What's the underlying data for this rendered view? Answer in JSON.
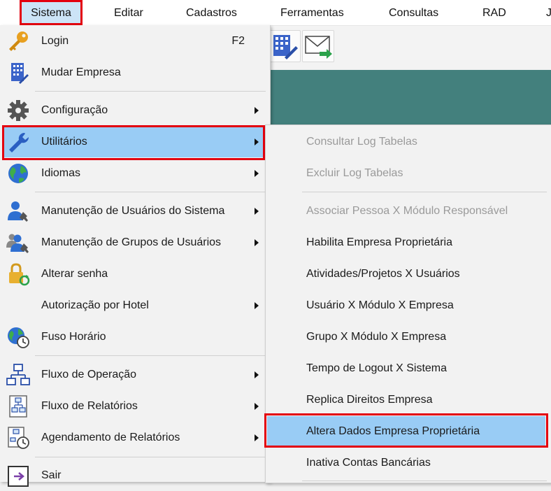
{
  "menubar": {
    "items": [
      "Sistema",
      "Editar",
      "Cadastros",
      "Ferramentas",
      "Consultas",
      "RAD",
      "J"
    ]
  },
  "sistema_menu": {
    "items": [
      {
        "label": "Login",
        "shortcut": "F2",
        "icon": "key-icon"
      },
      {
        "label": "Mudar Empresa",
        "icon": "building-icon"
      },
      {
        "label": "Configuração",
        "icon": "gear-icon",
        "submenu": true
      },
      {
        "label": "Utilitários",
        "icon": "wrench-icon",
        "submenu": true,
        "active": true
      },
      {
        "label": "Idiomas",
        "icon": "globe-icon",
        "submenu": true
      },
      {
        "label": "Manutenção de Usuários do Sistema",
        "icon": "user-settings-icon",
        "submenu": true
      },
      {
        "label": "Manutenção de Grupos de Usuários",
        "icon": "group-settings-icon",
        "submenu": true
      },
      {
        "label": "Alterar senha",
        "icon": "lock-refresh-icon"
      },
      {
        "label": "Autorização por Hotel",
        "submenu": true
      },
      {
        "label": "Fuso Horário",
        "icon": "globe-clock-icon"
      },
      {
        "label": "Fluxo de Operação",
        "icon": "flowchart-icon",
        "submenu": true
      },
      {
        "label": "Fluxo de Relatórios",
        "icon": "report-flow-icon",
        "submenu": true
      },
      {
        "label": "Agendamento de Relatórios",
        "icon": "report-schedule-icon",
        "submenu": true
      },
      {
        "label": "Sair",
        "icon": "exit-icon"
      }
    ]
  },
  "utilitarios_menu": {
    "items": [
      {
        "label": "Consultar Log Tabelas",
        "disabled": true
      },
      {
        "label": "Excluir Log Tabelas",
        "disabled": true
      },
      {
        "label": "Associar Pessoa X Módulo Responsável",
        "disabled": true
      },
      {
        "label": "Habilita Empresa Proprietária"
      },
      {
        "label": "Atividades/Projetos X Usuários"
      },
      {
        "label": "Usuário X Módulo X Empresa"
      },
      {
        "label": "Grupo X Módulo X Empresa"
      },
      {
        "label": "Tempo de Logout X Sistema"
      },
      {
        "label": "Replica Direitos Empresa"
      },
      {
        "label": "Altera Dados Empresa Proprietária",
        "active": true
      },
      {
        "label": "Inativa Contas Bancárias"
      }
    ]
  },
  "colors": {
    "highlight_box": "#e3000f",
    "hover_blue": "#99ccf5",
    "teal_background": "#43807d"
  }
}
